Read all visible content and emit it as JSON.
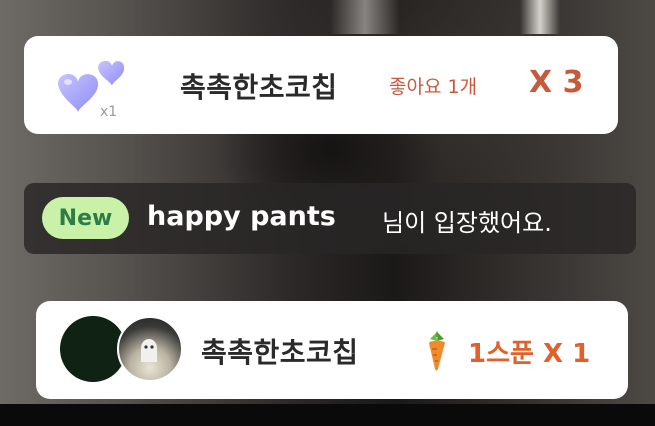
{
  "like_notification": {
    "username": "촉촉한초코칩",
    "label": "좋아요 1개",
    "multiplier": "X 3",
    "icon": "hearts-icon",
    "hearts_badge": "x1",
    "accent_color": "#c85a3c"
  },
  "entry_notification": {
    "badge": "New",
    "username": "happy pants",
    "message": "님이 입장했어요."
  },
  "spoon_notification": {
    "username": "촉촉한초코칩",
    "amount": "1스푼 X 1",
    "icon": "carrot-icon",
    "accent_color": "#e1612b"
  }
}
